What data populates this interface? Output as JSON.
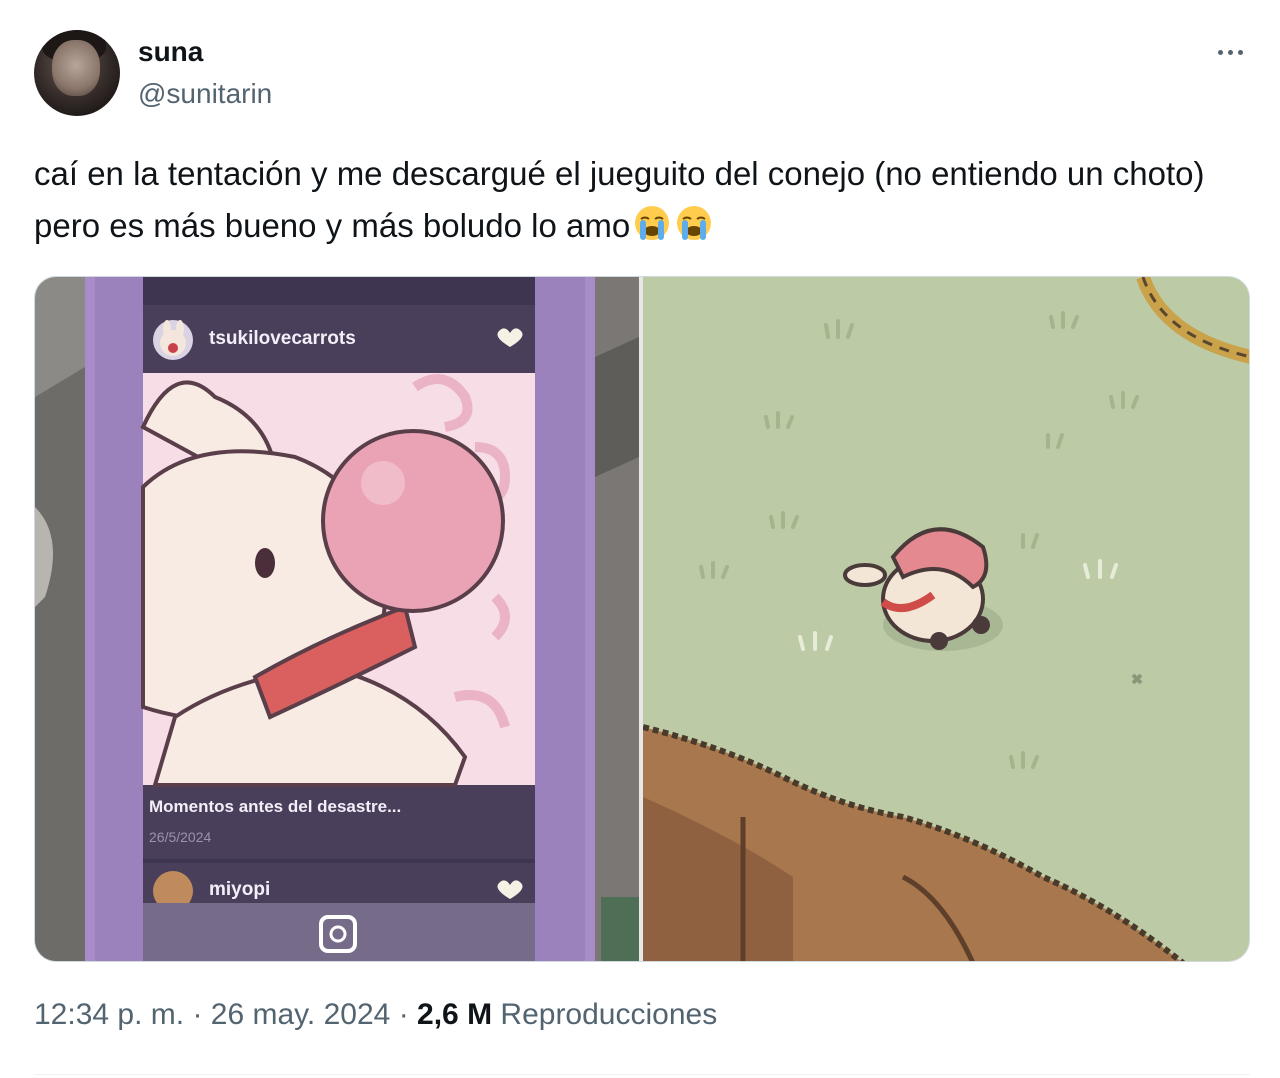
{
  "author": {
    "display_name": "suna",
    "handle": "@sunitarin"
  },
  "tweet": {
    "text": "caí en la tentación y me descargué el jueguito del conejo (no entiendo un choto) pero es más bueno y más boludo lo amo",
    "emojis": [
      "loudly-crying-face-icon",
      "loudly-crying-face-icon"
    ]
  },
  "media_left": {
    "post_1": {
      "username": "tsukilovecarrots",
      "caption": "Momentos antes del desastre...",
      "date": "26/5/2024"
    },
    "post_2": {
      "username": "miyopi"
    }
  },
  "meta": {
    "time": "12:34 p. m.",
    "separator": "·",
    "date": "26 may. 2024",
    "views_count": "2,6 M",
    "views_label": "Reproducciones"
  },
  "colors": {
    "text_primary": "#0f1419",
    "text_secondary": "#536471",
    "phone_frame": "#a88cc8",
    "app_bg": "#4a3f5a",
    "grass": "#bccba6"
  }
}
